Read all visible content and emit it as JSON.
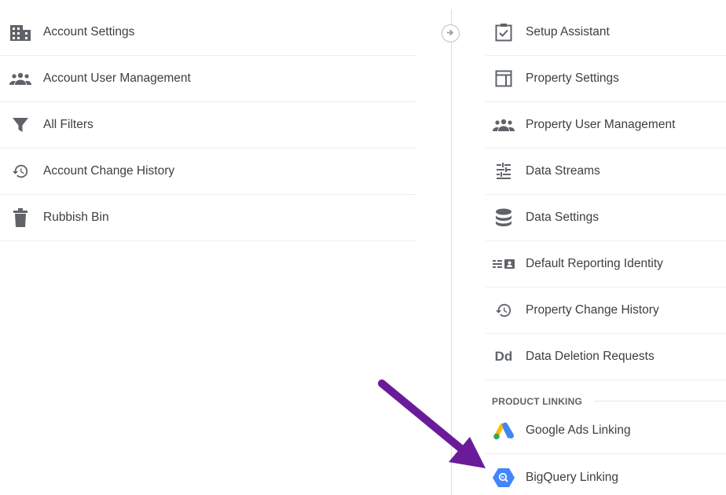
{
  "account_menu": {
    "items": [
      {
        "label": "Account Settings",
        "icon": "building-icon"
      },
      {
        "label": "Account User Management",
        "icon": "people-icon"
      },
      {
        "label": "All Filters",
        "icon": "filter-icon"
      },
      {
        "label": "Account Change History",
        "icon": "history-icon"
      },
      {
        "label": "Rubbish Bin",
        "icon": "trash-icon"
      }
    ]
  },
  "property_menu": {
    "items": [
      {
        "label": "Setup Assistant",
        "icon": "checklist-icon"
      },
      {
        "label": "Property Settings",
        "icon": "layout-icon"
      },
      {
        "label": "Property User Management",
        "icon": "people-icon"
      },
      {
        "label": "Data Streams",
        "icon": "streams-icon"
      },
      {
        "label": "Data Settings",
        "icon": "database-icon"
      },
      {
        "label": "Default Reporting Identity",
        "icon": "identity-icon"
      },
      {
        "label": "Property Change History",
        "icon": "history-icon"
      },
      {
        "label": "Data Deletion Requests",
        "icon": "dd-icon",
        "icon_text": "Dd"
      }
    ]
  },
  "product_linking": {
    "header": "PRODUCT LINKING",
    "items": [
      {
        "label": "Google Ads Linking",
        "icon": "google-ads-icon"
      },
      {
        "label": "BigQuery Linking",
        "icon": "bigquery-icon"
      }
    ]
  },
  "colors": {
    "icon_gray": "#5f6368",
    "text": "#3c4043",
    "arrow_annotation": "#6a1b9a",
    "ads_blue": "#4285f4",
    "ads_yellow": "#fbbc04",
    "ads_green": "#34a853",
    "bigquery_blue": "#4386fa"
  }
}
